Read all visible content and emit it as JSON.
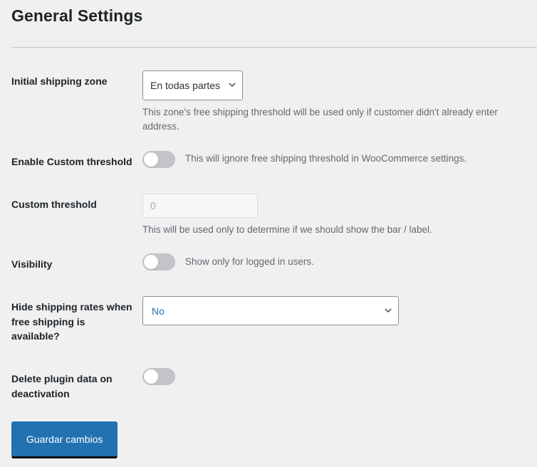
{
  "page": {
    "title": "General Settings"
  },
  "rows": [
    {
      "label": "Initial shipping zone",
      "control": "select-small",
      "value": "En todas partes",
      "description": "This zone's free shipping threshold will be used only if customer didn't already enter address."
    },
    {
      "label": "Enable Custom threshold",
      "control": "toggle",
      "value": "off",
      "description": "This will ignore free shipping threshold in WooCommerce settings."
    },
    {
      "label": "Custom threshold",
      "control": "text",
      "value": "",
      "placeholder": "0",
      "description": "This will be used only to determine if we should show the bar / label."
    },
    {
      "label": "Visibility",
      "control": "toggle",
      "value": "off",
      "description": "Show only for logged in users."
    },
    {
      "label": "Hide shipping rates when free shipping is available?",
      "control": "select-wide",
      "value": "No",
      "description": ""
    },
    {
      "label": "Delete plugin data on deactivation",
      "control": "toggle",
      "value": "off",
      "description": ""
    }
  ],
  "submit": {
    "label": "Guardar cambios"
  },
  "colors": {
    "background": "#f0f0f1",
    "label_text": "#1d2327",
    "description_text": "#646970",
    "accent": "#2271b1",
    "toggle_off_track": "#c3c4c7",
    "border": "#8c8f94",
    "divider": "#c3c4c7"
  },
  "icons": {
    "chevron_down": "chevron-down-icon"
  }
}
